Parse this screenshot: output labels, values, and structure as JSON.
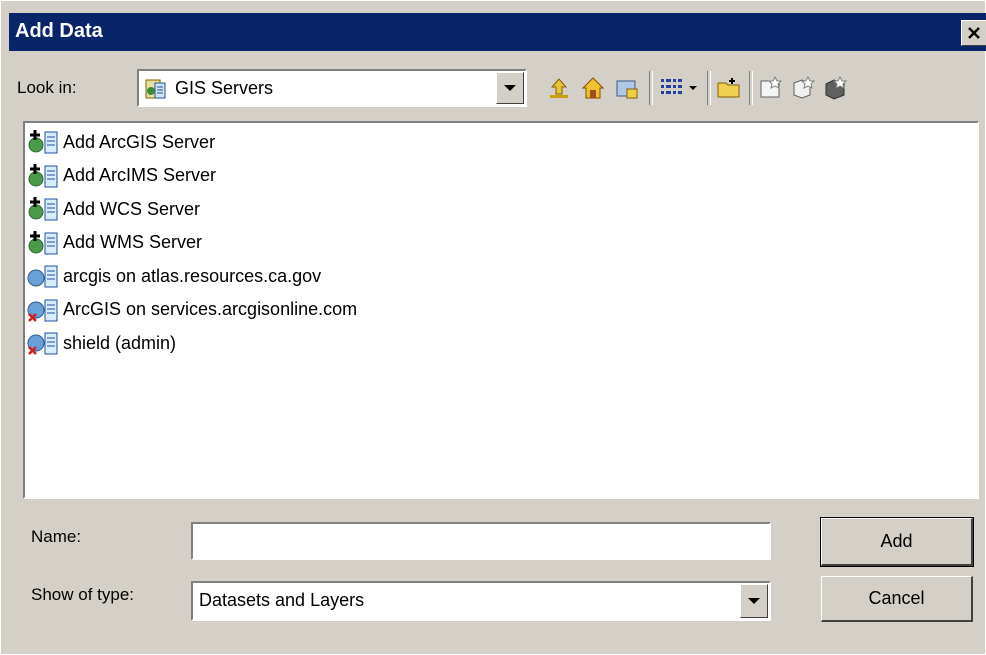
{
  "window": {
    "title": "Add Data",
    "close_icon": "close-icon"
  },
  "look_in": {
    "label": "Look in:",
    "value": "GIS Servers",
    "icon": "gis-servers-icon"
  },
  "toolbar": {
    "buttons": [
      {
        "icon": "up-one-level-icon"
      },
      {
        "icon": "home-icon"
      },
      {
        "icon": "connect-to-folder-icon"
      },
      {
        "icon": "view-list-icon"
      },
      {
        "icon": "view-dropdown-icon"
      },
      {
        "icon": "new-folder-icon"
      },
      {
        "icon": "new-shapefile-icon"
      },
      {
        "icon": "new-geodatabase-icon"
      },
      {
        "icon": "new-feature-icon"
      }
    ]
  },
  "list": {
    "items": [
      {
        "label": "Add ArcGIS Server",
        "icon": "add-server-icon"
      },
      {
        "label": "Add ArcIMS Server",
        "icon": "add-server-icon"
      },
      {
        "label": "Add WCS Server",
        "icon": "add-server-icon"
      },
      {
        "label": "Add WMS Server",
        "icon": "add-server-icon"
      },
      {
        "label": "arcgis on atlas.resources.ca.gov",
        "icon": "server-connection-icon"
      },
      {
        "label": "ArcGIS on services.arcgisonline.com",
        "icon": "server-connection-error-icon"
      },
      {
        "label": "shield (admin)",
        "icon": "server-connection-error-icon"
      }
    ]
  },
  "name": {
    "label": "Name:",
    "value": ""
  },
  "show_type": {
    "label": "Show of type:",
    "value": "Datasets and Layers"
  },
  "buttons": {
    "add": "Add",
    "cancel": "Cancel"
  },
  "colors": {
    "titlebar": "#0a246a",
    "face": "#d4d0c8"
  }
}
